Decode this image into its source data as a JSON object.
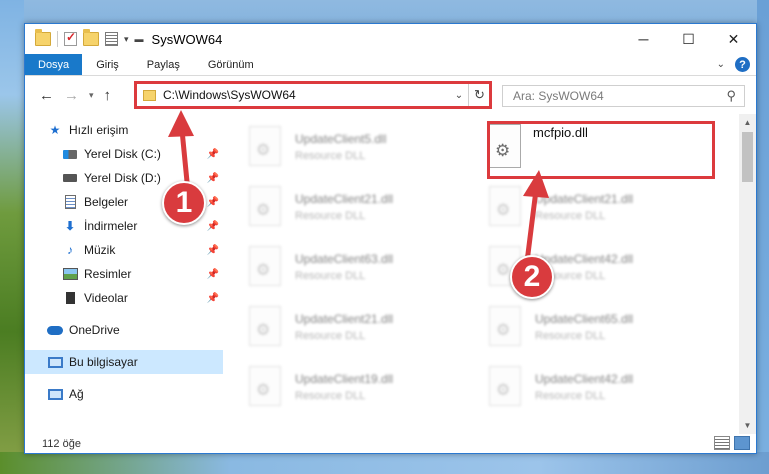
{
  "window": {
    "title": "SysWOW64",
    "controls": {
      "minimize": "─",
      "maximize": "☐",
      "close": "✕"
    }
  },
  "ribbon": {
    "tabs": [
      "Dosya",
      "Giriş",
      "Paylaş",
      "Görünüm"
    ],
    "help": "?"
  },
  "address": {
    "path": "C:\\Windows\\SysWOW64",
    "search_placeholder": "Ara: SysWOW64"
  },
  "sidebar": {
    "quick_access": "Hızlı erişim",
    "items": [
      {
        "label": "Yerel Disk (C:)",
        "pinned": true
      },
      {
        "label": "Yerel Disk (D:)",
        "pinned": true
      },
      {
        "label": "Belgeler",
        "pinned": true
      },
      {
        "label": "İndirmeler",
        "pinned": true
      },
      {
        "label": "Müzik",
        "pinned": true
      },
      {
        "label": "Resimler",
        "pinned": true
      },
      {
        "label": "Videolar",
        "pinned": true
      }
    ],
    "onedrive": "OneDrive",
    "this_pc": "Bu bilgisayar",
    "network": "Ağ"
  },
  "files": {
    "target": {
      "name": "mcfpio.dll"
    },
    "left_column": [
      {
        "name": "UpdateClient5.dll",
        "type": "Resource DLL"
      },
      {
        "name": "UpdateClient21.dll",
        "type": "Resource DLL"
      },
      {
        "name": "UpdateClient63.dll",
        "type": "Resource DLL"
      },
      {
        "name": "UpdateClient21.dll",
        "type": "Resource DLL"
      },
      {
        "name": "UpdateClient19.dll",
        "type": "Resource DLL"
      }
    ],
    "right_column": [
      {
        "name": "UpdateClient21.dll",
        "type": "Resource DLL"
      },
      {
        "name": "UpdateClient42.dll",
        "type": "Resource DLL"
      },
      {
        "name": "UpdateClient65.dll",
        "type": "Resource DLL"
      },
      {
        "name": "UpdateClient42.dll",
        "type": "Resource DLL"
      }
    ]
  },
  "status": {
    "item_count": "112 öğe"
  },
  "annotations": {
    "step1": "1",
    "step2": "2",
    "color": "#d93b3e"
  }
}
